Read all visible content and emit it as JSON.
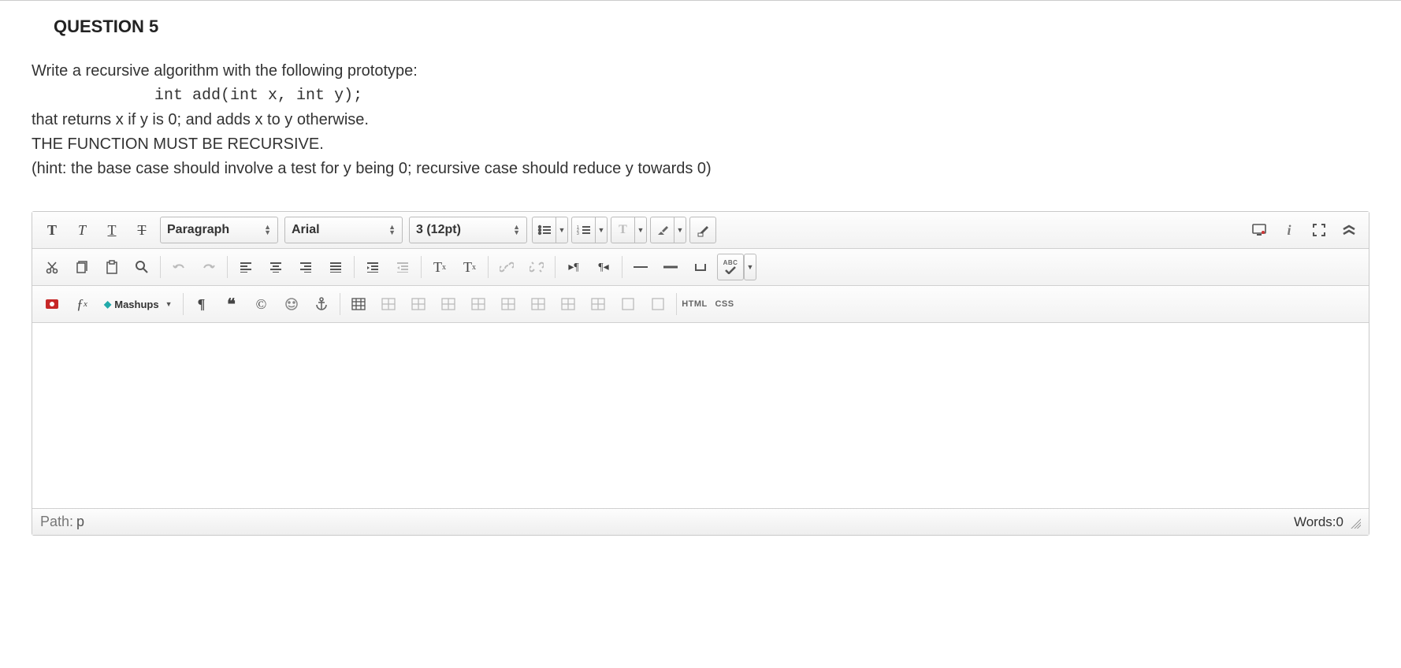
{
  "question": {
    "title": "QUESTION 5",
    "line1": "Write a recursive algorithm with the following prototype:",
    "code": "             int add(int x, int y);",
    "line2": "that returns x if y is 0; and adds x to y otherwise.",
    "line3": "THE FUNCTION MUST BE RECURSIVE.",
    "line4": "(hint: the base case should involve a test for y being 0; recursive case should reduce y towards 0)"
  },
  "toolbar": {
    "format_select": "Paragraph",
    "font_select": "Arial",
    "size_select": "3 (12pt)",
    "mashups_label": "Mashups",
    "html_label": "HTML",
    "css_label": "CSS",
    "abc_label": "ABC"
  },
  "status": {
    "path_label": "Path:",
    "path_value": "p",
    "words_label": "Words:",
    "words_value": "0"
  }
}
